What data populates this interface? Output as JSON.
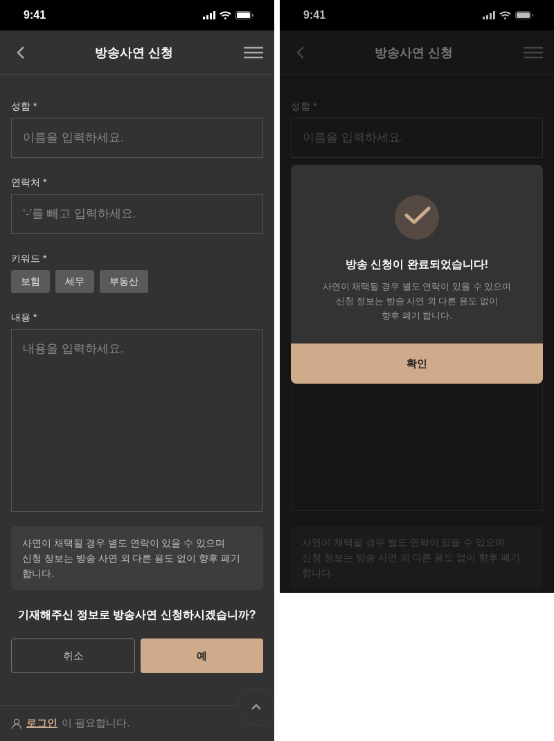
{
  "form_screen": {
    "status_time": "9:41",
    "title": "방송사연 신청",
    "fields": [
      {
        "kind": "input",
        "label": "성함 *",
        "placeholder": "이름을 입력하세요."
      },
      {
        "kind": "input",
        "label": "연락처 *",
        "placeholder": "‘-’를 빼고 입력하세요."
      },
      {
        "kind": "chips",
        "label": "키워드 *",
        "chips": [
          "보험",
          "세무",
          "부동산"
        ]
      },
      {
        "kind": "textarea",
        "label": "내용 *",
        "placeholder": "내용을 입력하세요."
      }
    ],
    "notice_lines": [
      "사연이 채택될 경우 별도 연락이 있을 수 있으며",
      "신청 정보는 방송 사연 외 다른 용도 없이 향후 폐기",
      "합니다."
    ],
    "question": "기재해주신 정보로 방송사연 신청하시겠습니까?",
    "buttons": [
      {
        "kind": "secondary",
        "label": "취소"
      },
      {
        "kind": "primary",
        "label": "예"
      }
    ],
    "footer": {
      "link": "로그인",
      "text": "이 필요합니다."
    }
  },
  "completed_screen": {
    "status_time": "9:41",
    "title": "방송사연 신청",
    "name_label": "성함 *",
    "name_placeholder": "이름을 입력하세요.",
    "dialog": {
      "title": "방송 신청이 완료되었습니다!",
      "message_lines": [
        "사연이 채택될 경우 별도 연락이 있을 수 있으며",
        "신청 정보는 방송 사연 외 다른 용도 없이",
        "향후 폐기 합니다."
      ],
      "confirm": "확인"
    },
    "notice_lines": [
      "사연이 채택될 경우 별도 연락이 있을 수 있으며",
      "신청 정보는 방송 사연 외 다른 용도 없이 향후 폐기",
      "합니다."
    ]
  }
}
